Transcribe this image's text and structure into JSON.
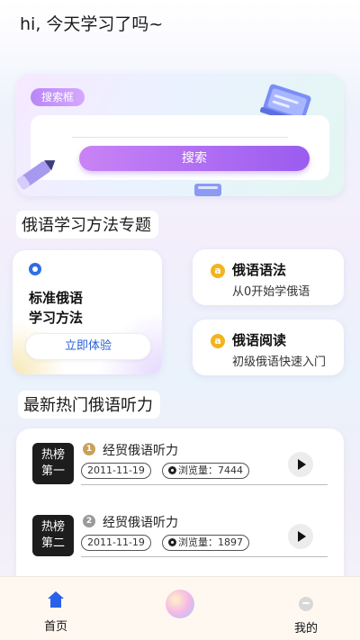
{
  "header": {
    "greeting": "hi, 今天学习了吗~"
  },
  "search": {
    "tag": "搜索框",
    "button_label": "搜索"
  },
  "methods": {
    "section_title": "俄语学习方法专题",
    "featured": {
      "title_line1": "标准俄语",
      "title_line2": "学习方法",
      "cta": "立即体验"
    },
    "cards": [
      {
        "title": "俄语语法",
        "subtitle": "从0开始学俄语",
        "badge": "a"
      },
      {
        "title": "俄语阅读",
        "subtitle": "初级俄语快速入门",
        "badge": "a"
      }
    ]
  },
  "listening": {
    "section_title": "最新热门俄语听力",
    "items": [
      {
        "thumb_line1": "热榜",
        "thumb_line2": "第一",
        "rank": "1",
        "rank_color": "#c9a25a",
        "title": "经贸俄语听力",
        "date": "2011-11-19",
        "views_label": "浏览量：7444"
      },
      {
        "thumb_line1": "热榜",
        "thumb_line2": "第二",
        "rank": "2",
        "rank_color": "#9a9a9a",
        "title": "经贸俄语听力",
        "date": "2011-11-19",
        "views_label": "浏览量：1897"
      }
    ]
  },
  "nav": {
    "home_label": "首页",
    "me_label": "我的"
  },
  "colors": {
    "accent_blue": "#2862e8",
    "search_purple": "#9a5cf0",
    "badge_gold": "#f2b31d"
  },
  "icons": [
    "home-icon",
    "user-icon",
    "eye-icon",
    "play-icon",
    "book-illustration",
    "pencil-illustration"
  ]
}
